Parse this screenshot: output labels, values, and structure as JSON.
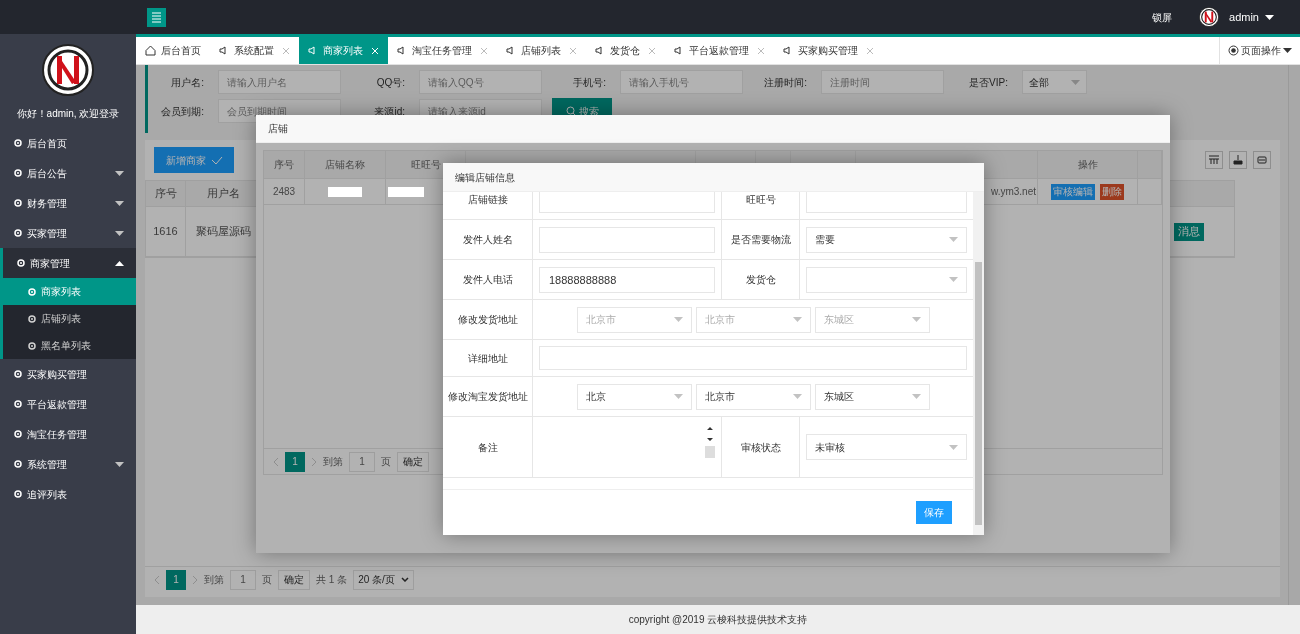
{
  "topbar": {
    "lock": "锁屏",
    "user": "admin"
  },
  "sidebar": {
    "greeting": "你好！admin, 欢迎登录",
    "items": [
      {
        "label": "后台首页",
        "kind": "link",
        "selected": false
      },
      {
        "label": "后台公告",
        "kind": "group",
        "expanded": false,
        "selected": false
      },
      {
        "label": "财务管理",
        "kind": "group",
        "expanded": false,
        "selected": false
      },
      {
        "label": "买家管理",
        "kind": "group",
        "expanded": false,
        "selected": false
      },
      {
        "label": "商家管理",
        "kind": "group",
        "expanded": true,
        "selected": false,
        "children": [
          {
            "label": "商家列表",
            "selected": true
          },
          {
            "label": "店铺列表",
            "selected": false
          },
          {
            "label": "黑名单列表",
            "selected": false
          }
        ]
      },
      {
        "label": "买家购买管理",
        "kind": "link",
        "selected": false
      },
      {
        "label": "平台返款管理",
        "kind": "link",
        "selected": false
      },
      {
        "label": "淘宝任务管理",
        "kind": "link",
        "selected": false
      },
      {
        "label": "系统管理",
        "kind": "group",
        "expanded": false,
        "selected": false
      },
      {
        "label": "追评列表",
        "kind": "link",
        "selected": false
      }
    ]
  },
  "tabs": [
    {
      "label": "后台首页",
      "kind": "home",
      "closable": false,
      "selected": false
    },
    {
      "label": "系统配置",
      "kind": "page",
      "closable": true,
      "selected": false
    },
    {
      "label": "商家列表",
      "kind": "page",
      "closable": true,
      "selected": true
    },
    {
      "label": "淘宝任务管理",
      "kind": "page",
      "closable": true,
      "selected": false
    },
    {
      "label": "店铺列表",
      "kind": "page",
      "closable": true,
      "selected": false
    },
    {
      "label": "发货仓",
      "kind": "page",
      "closable": true,
      "selected": false
    },
    {
      "label": "平台返款管理",
      "kind": "page",
      "closable": true,
      "selected": false
    },
    {
      "label": "买家购买管理",
      "kind": "page",
      "closable": true,
      "selected": false
    }
  ],
  "page_ops": "页面操作",
  "filter": {
    "fields": [
      {
        "label": "用户名:",
        "kind": "input",
        "placeholder": "请输入用户名"
      },
      {
        "label": "QQ号:",
        "kind": "input",
        "placeholder": "请输入QQ号"
      },
      {
        "label": "手机号:",
        "kind": "input",
        "placeholder": "请输入手机号"
      },
      {
        "label": "注册时间:",
        "kind": "input",
        "placeholder": "注册时间"
      },
      {
        "label": "是否VIP:",
        "kind": "select",
        "value": "全部"
      },
      {
        "label": "会员到期:",
        "kind": "input",
        "placeholder": "会员到期时间"
      },
      {
        "label": "来源id:",
        "kind": "input",
        "placeholder": "请输入来源id"
      }
    ],
    "search_button": "搜索"
  },
  "add_button": "新增商家",
  "table": {
    "columns": [
      "序号",
      "用户名"
    ],
    "rows": [
      {
        "cells": [
          "1616",
          "聚码屋源码"
        ],
        "action": "消息"
      }
    ]
  },
  "pagination": {
    "current": "1",
    "goto_label": "到第",
    "goto_value": "1",
    "page_unit": "页",
    "confirm": "确定",
    "total": "共 1 条",
    "page_size": "20 条/页"
  },
  "shop_dialog": {
    "title": "店铺",
    "columns": [
      "序号",
      "店铺名称",
      "旺旺号",
      "操作"
    ],
    "rows": [
      {
        "id": "2483",
        "name_redacted": true,
        "wangwang_redacted": true,
        "info": "w.ym3.net",
        "actions": [
          {
            "label": "审核编辑",
            "kind": "primary"
          },
          {
            "label": "删除",
            "kind": "danger"
          }
        ]
      }
    ],
    "pagination": {
      "current": "1",
      "goto_label": "到第",
      "goto_value": "1",
      "page_unit": "页",
      "confirm": "确定"
    }
  },
  "edit_dialog": {
    "title": "编辑店铺信息",
    "rows": [
      {
        "kind": "pair",
        "fields": [
          {
            "label": "店铺链接",
            "kind": "input"
          },
          {
            "label": "旺旺号",
            "kind": "input"
          }
        ]
      },
      {
        "kind": "pair",
        "fields": [
          {
            "label": "发件人姓名",
            "kind": "input"
          },
          {
            "label": "是否需要物流",
            "kind": "select",
            "value": "需要"
          }
        ]
      },
      {
        "kind": "pair",
        "fields": [
          {
            "label": "发件人电话",
            "kind": "input",
            "value": "18888888888"
          },
          {
            "label": "发货仓",
            "kind": "select"
          }
        ]
      },
      {
        "kind": "region",
        "label": "修改发货地址",
        "disabled": true,
        "selects": [
          "北京市",
          "北京市",
          "东城区"
        ]
      },
      {
        "kind": "textarea",
        "label": "详细地址"
      },
      {
        "kind": "region",
        "label": "修改淘宝发货地址",
        "disabled": false,
        "selects": [
          "北京",
          "北京市",
          "东城区"
        ]
      },
      {
        "kind": "pair",
        "fields": [
          {
            "label": "备注",
            "kind": "textarea"
          },
          {
            "label": "审核状态",
            "kind": "select",
            "value": "未审核"
          }
        ]
      }
    ],
    "save": "保存"
  },
  "footer": "copyright @2019 云梭科技提供技术支持"
}
